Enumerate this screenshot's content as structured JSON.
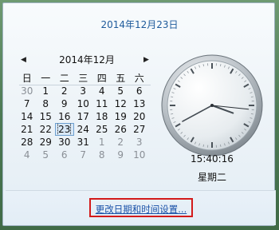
{
  "full_date": "2014年12月23日",
  "calendar": {
    "month_title": "2014年12月",
    "prev_icon": "triangle-left-icon",
    "next_icon": "triangle-right-icon",
    "weekdays": [
      "日",
      "一",
      "二",
      "三",
      "四",
      "五",
      "六"
    ],
    "weeks": [
      [
        {
          "d": "30",
          "o": true
        },
        {
          "d": "1"
        },
        {
          "d": "2"
        },
        {
          "d": "3"
        },
        {
          "d": "4"
        },
        {
          "d": "5"
        },
        {
          "d": "6"
        }
      ],
      [
        {
          "d": "7"
        },
        {
          "d": "8"
        },
        {
          "d": "9"
        },
        {
          "d": "10"
        },
        {
          "d": "11"
        },
        {
          "d": "12"
        },
        {
          "d": "13"
        }
      ],
      [
        {
          "d": "14"
        },
        {
          "d": "15"
        },
        {
          "d": "16"
        },
        {
          "d": "17"
        },
        {
          "d": "18"
        },
        {
          "d": "19"
        },
        {
          "d": "20"
        }
      ],
      [
        {
          "d": "21"
        },
        {
          "d": "22"
        },
        {
          "d": "23",
          "today": true
        },
        {
          "d": "24"
        },
        {
          "d": "25"
        },
        {
          "d": "26"
        },
        {
          "d": "27"
        }
      ],
      [
        {
          "d": "28"
        },
        {
          "d": "29"
        },
        {
          "d": "30"
        },
        {
          "d": "31"
        },
        {
          "d": "1",
          "o": true
        },
        {
          "d": "2",
          "o": true
        },
        {
          "d": "3",
          "o": true
        }
      ],
      [
        {
          "d": "4",
          "o": true
        },
        {
          "d": "5",
          "o": true
        },
        {
          "d": "6",
          "o": true
        },
        {
          "d": "7",
          "o": true
        },
        {
          "d": "8",
          "o": true
        },
        {
          "d": "9",
          "o": true
        },
        {
          "d": "10",
          "o": true
        }
      ]
    ]
  },
  "clock": {
    "hour": 15,
    "minute": 40,
    "second": 16
  },
  "time_text": "15:40:16",
  "weekday_text": "星期二",
  "change_link": "更改日期和时间设置...",
  "colors": {
    "accent": "#1e5a9b",
    "link": "#1a52a8",
    "highlight_box": "#d31a1a"
  }
}
